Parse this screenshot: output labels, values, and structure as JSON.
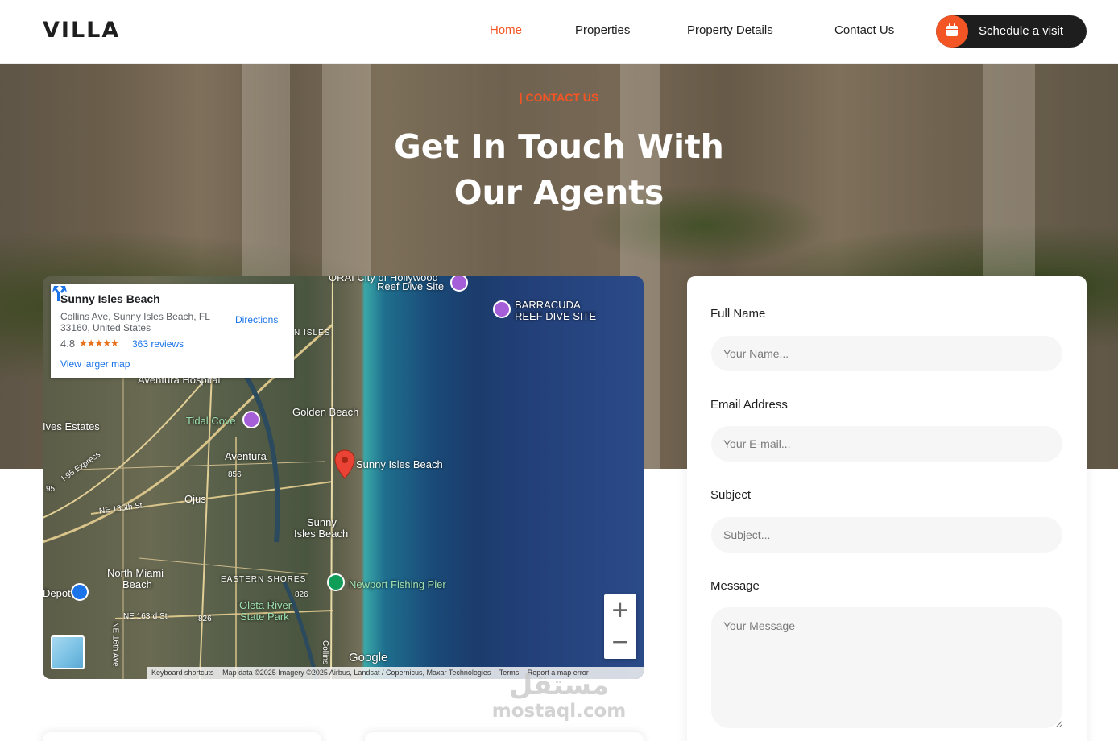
{
  "header": {
    "logo": "VILLA",
    "nav": [
      {
        "label": "Home",
        "active": true
      },
      {
        "label": "Properties",
        "active": false
      },
      {
        "label": "Property Details",
        "active": false
      },
      {
        "label": "Contact Us",
        "active": false
      }
    ],
    "cta_label": "Schedule a visit",
    "cta_icon": "calendar-icon"
  },
  "hero": {
    "tag": "| CONTACT US",
    "title_line1": "Get In Touch With",
    "title_line2": "Our Agents"
  },
  "map": {
    "place_name": "Sunny Isles Beach",
    "address": "Collins Ave, Sunny Isles Beach, FL 33160, United States",
    "rating": "4.8",
    "stars": "★★★★★",
    "reviews": "363 reviews",
    "directions": "Directions",
    "larger_map": "View larger map",
    "zoom_in": "+",
    "zoom_out": "−",
    "google": "Google",
    "labels": {
      "reef": "Reef Dive Site",
      "reef_top": "ORAI City of Hollywood",
      "barracuda1": "BARRACUDA",
      "barracuda2": "REEF DIVE SITE",
      "isles": "N ISLES",
      "hospital": "Aventura Hospital",
      "tidal": "Tidal Cove",
      "golden": "Golden Beach",
      "ives": "Ives Estates",
      "expressway": "I-95 Express",
      "aventura": "Aventura",
      "sunny_pin": "Sunny Isles Beach",
      "ojus": "Ojus",
      "ne185": "NE 185th St",
      "sunny1": "Sunny",
      "sunny2": "Isles Beach",
      "north1": "North Miami",
      "north2": "Beach",
      "eastern": "EASTERN SHORES",
      "pier": "Newport Fishing Pier",
      "depot": "Depot",
      "oleta1": "Oleta River",
      "oleta2": "State Park",
      "ne163": "NE 163rd St",
      "ne16": "NE 16th Ave",
      "collins": "Collins",
      "r856": "856",
      "r826a": "826",
      "r826b": "826",
      "r95": "95"
    },
    "footer": {
      "shortcuts": "Keyboard shortcuts",
      "data": "Map data ©2025 Imagery ©2025 Airbus, Landsat / Copernicus, Maxar Technologies",
      "terms": "Terms",
      "report": "Report a map error"
    }
  },
  "form": {
    "name_label": "Full Name",
    "name_placeholder": "Your Name...",
    "email_label": "Email Address",
    "email_placeholder": "Your E-mail...",
    "subject_label": "Subject",
    "subject_placeholder": "Subject...",
    "message_label": "Message",
    "message_placeholder": "Your Message"
  },
  "watermark": {
    "arabic": "مستقل",
    "latin": "mostaql.com"
  },
  "colors": {
    "accent": "#f35525",
    "dark": "#1e1e1e",
    "input_bg": "#f6f6f6"
  }
}
